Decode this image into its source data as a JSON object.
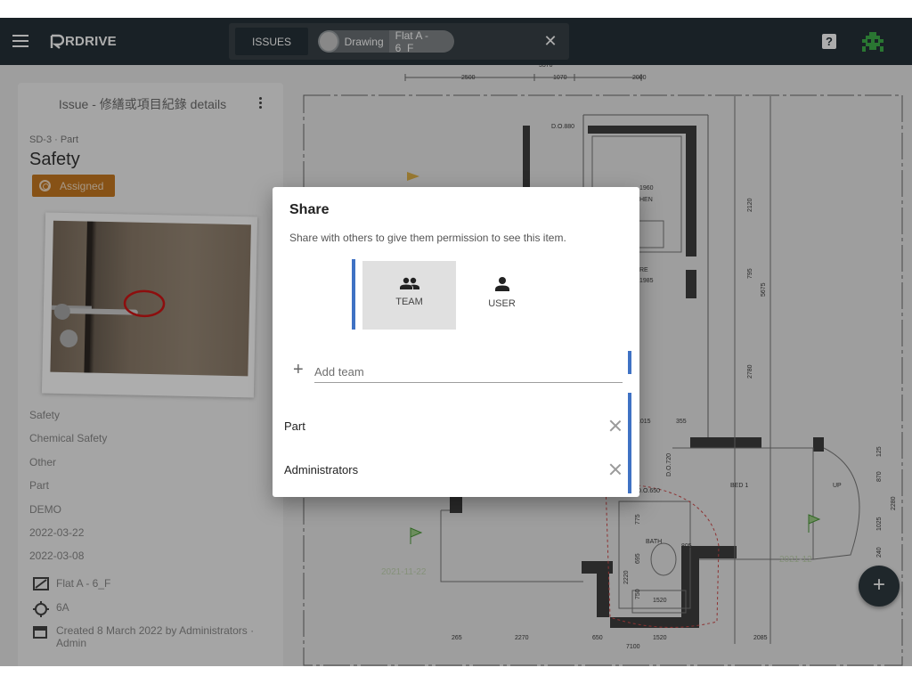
{
  "topbar": {
    "app_name": "RDRIVE",
    "tab_issues": "ISSUES",
    "filter_chip": {
      "label": "Drawing",
      "value": "Flat A - 6_F"
    },
    "help_icon": "?"
  },
  "issue_panel": {
    "header": "Issue - 修繕或項目紀錄 details",
    "meta": "SD-3 · Part",
    "title": "Safety",
    "status": "Assigned",
    "status_color": "#c87a21",
    "fields": [
      "Safety",
      "Chemical Safety",
      "Other",
      "Part",
      "DEMO",
      "2022-03-22",
      "2022-03-08"
    ],
    "drawing": "Flat A - 6_F",
    "location": "6A",
    "created_line1": "Created 8 March 2022 by Administrators ·",
    "created_line2": "Admin"
  },
  "share_dialog": {
    "title": "Share",
    "subtitle": "Share with others to give them permission to see this item.",
    "toggle_team": "TEAM",
    "toggle_user": "USER",
    "add_placeholder": "Add team",
    "teams": [
      "Part",
      "Administrators"
    ],
    "accent_color": "#3f72c4"
  },
  "fab_label": "+",
  "drawing_labels": {
    "dim_top": [
      "5370",
      "2500",
      "1070",
      "2000"
    ],
    "room_do880": "D.O.880",
    "kitchen": "1960",
    "kitchen_name": "HEN",
    "store": "RE",
    "store_dim": "1985",
    "right_dims": [
      "2120",
      "795",
      "5675",
      "2780"
    ],
    "do_720": "D.O.720",
    "bed1": "BED 1",
    "up": "UP",
    "bath": "BATH",
    "d650": "D.O.650",
    "d1015": "1015",
    "d355": "355",
    "bath_dims": [
      "775",
      "695",
      "2220",
      "805",
      "750",
      "1520"
    ],
    "right_side_dims": [
      "125",
      "870",
      "2280",
      "1025",
      "240"
    ],
    "left_dim": "2385",
    "date_stamp": "2021-11-22",
    "date_stamp2": "2021-12",
    "bottom_dims": [
      "265",
      "2270",
      "650",
      "1520",
      "2085",
      "7100"
    ]
  }
}
